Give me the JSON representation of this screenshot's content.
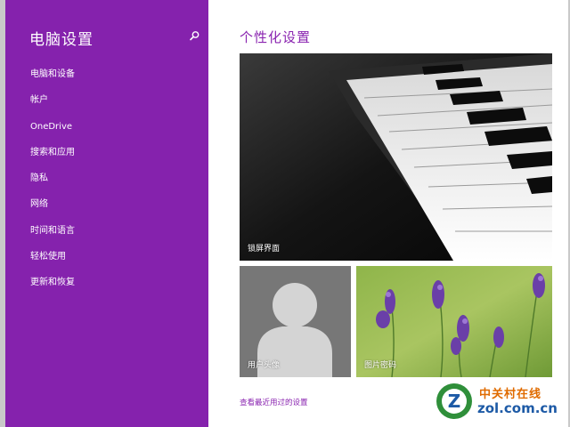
{
  "sidebar": {
    "title": "电脑设置",
    "search_icon": "search-icon",
    "items": [
      {
        "label": "电脑和设备"
      },
      {
        "label": "帐户"
      },
      {
        "label": "OneDrive"
      },
      {
        "label": "搜索和应用"
      },
      {
        "label": "隐私"
      },
      {
        "label": "网络"
      },
      {
        "label": "时间和语言"
      },
      {
        "label": "轻松使用"
      },
      {
        "label": "更新和恢复"
      }
    ]
  },
  "main": {
    "title": "个性化设置",
    "lock_screen_label": "锁屏界面",
    "account_picture_label": "用户头像",
    "picture_password_label": "图片密码",
    "recent_settings_link": "查看最近用过的设置"
  },
  "watermark": {
    "brand_cn": "中关村在线",
    "brand_en": "zol.com.cn"
  },
  "colors": {
    "sidebar_bg": "#8522ad",
    "accent": "#8a24b0"
  }
}
